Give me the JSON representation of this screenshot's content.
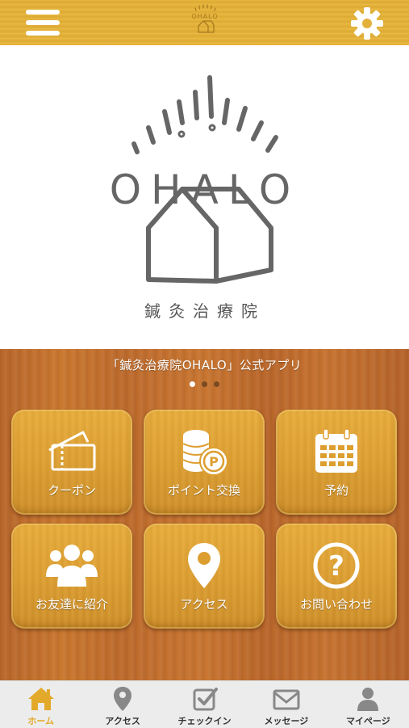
{
  "header": {
    "menu_icon": "hamburger-menu-icon",
    "settings_icon": "gear-icon",
    "logo_text": "OHALO",
    "accent_color": "#e4b03c"
  },
  "hero": {
    "logo_text": "OHALO",
    "logo_subtitle": "鍼灸治療院"
  },
  "banner": {
    "caption": "「鍼灸治療院OHALO」公式アプリ",
    "page_count": 3,
    "active_page": 1
  },
  "tiles": [
    {
      "label": "クーポン",
      "icon": "ticket-icon"
    },
    {
      "label": "ポイント交換",
      "icon": "coins-points-icon"
    },
    {
      "label": "予約",
      "icon": "calendar-icon"
    },
    {
      "label": "お友達に紹介",
      "icon": "people-group-icon"
    },
    {
      "label": "アクセス",
      "icon": "map-pin-icon"
    },
    {
      "label": "お問い合わせ",
      "icon": "question-icon"
    }
  ],
  "tabbar": {
    "active_color": "#e3a92a",
    "items": [
      {
        "label": "ホーム",
        "icon": "home-icon",
        "active": true
      },
      {
        "label": "アクセス",
        "icon": "map-pin-icon",
        "active": false
      },
      {
        "label": "チェックイン",
        "icon": "checkbox-icon",
        "active": false
      },
      {
        "label": "メッセージ",
        "icon": "envelope-icon",
        "active": false
      },
      {
        "label": "マイページ",
        "icon": "user-icon",
        "active": false
      }
    ]
  }
}
